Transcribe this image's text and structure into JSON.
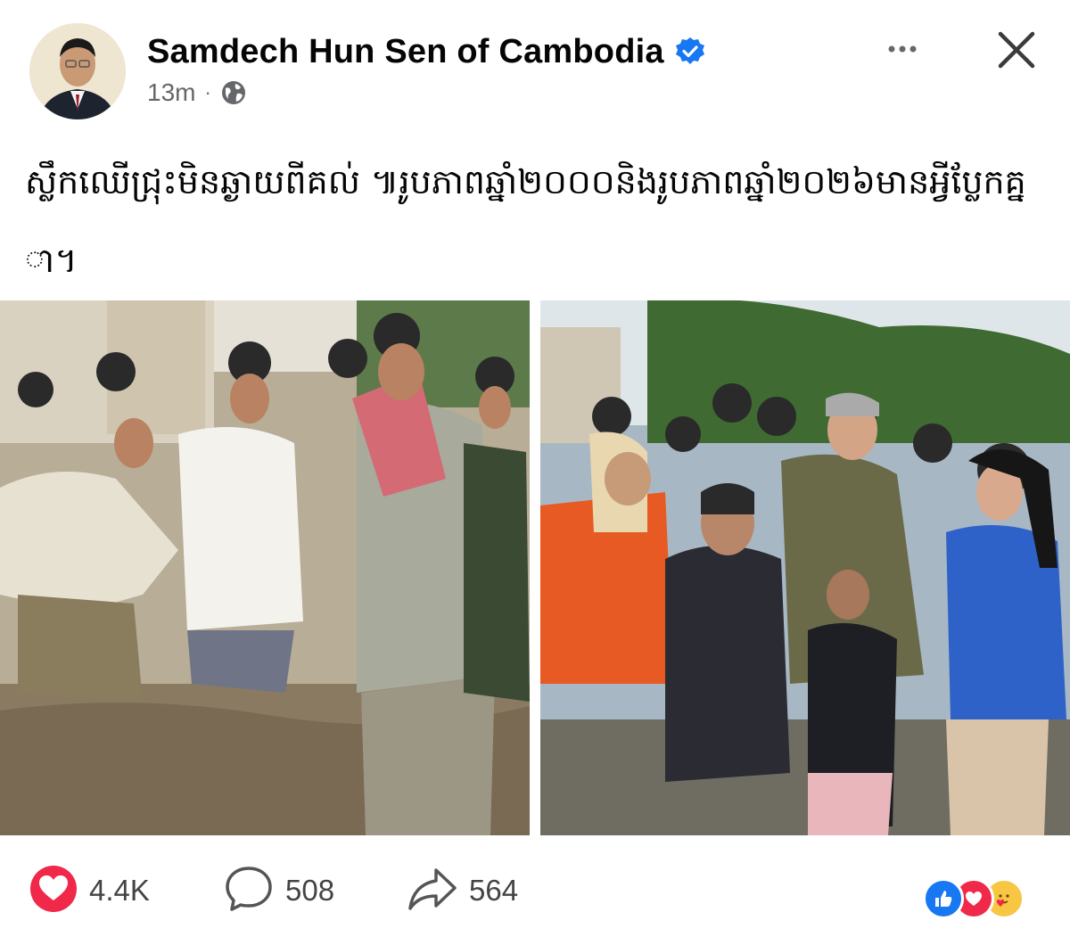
{
  "post": {
    "author": "Samdech Hun Sen of Cambodia",
    "time": "13m",
    "meta_separator": "·",
    "caption": "ស្លឹកឈើជ្រុះមិនឆ្ងាយពីគល់ ៕រូបភាពឆ្នាំ២០០០និងរូបភាពឆ្នាំ២០២៦មានអ្វីប្លែកគ្នា។"
  },
  "engagement": {
    "likes": "4.4K",
    "comments": "508",
    "shares": "564"
  },
  "colors": {
    "verified": "#1877f2",
    "like_heart": "#f02849",
    "secondary_text": "#65676b"
  },
  "icons": {
    "verified": "verified-badge-icon",
    "privacy": "globe-icon",
    "more": "more-options-icon",
    "close": "close-icon",
    "like": "heart-icon",
    "comment": "comment-bubble-icon",
    "share": "share-arrow-icon"
  }
}
